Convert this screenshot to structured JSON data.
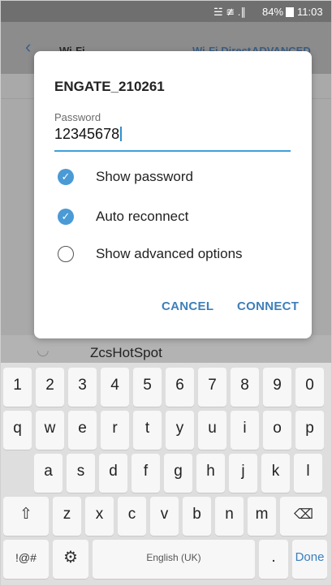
{
  "status_bar": {
    "signal_text": "☱ ≇ .∥",
    "battery": "84%",
    "time": "11:03"
  },
  "app_bar": {
    "back_icon": "back-arrow-icon",
    "title": "Wi-Fi",
    "wifi_direct": "Wi-Fi Direct",
    "advanced": "ADVANCED"
  },
  "background": {
    "network_name": "ZcsHotSpot"
  },
  "dialog": {
    "ssid": "ENGATE_210261",
    "password_label": "Password",
    "password_value": "12345678",
    "options": [
      {
        "label": "Show password",
        "checked": true
      },
      {
        "label": "Auto reconnect",
        "checked": true
      },
      {
        "label": "Show advanced options",
        "checked": false
      }
    ],
    "cancel": "CANCEL",
    "connect": "CONNECT"
  },
  "keyboard": {
    "row1": [
      "1",
      "2",
      "3",
      "4",
      "5",
      "6",
      "7",
      "8",
      "9",
      "0"
    ],
    "row2": [
      "q",
      "w",
      "e",
      "r",
      "t",
      "y",
      "u",
      "i",
      "o",
      "p"
    ],
    "row3": [
      "a",
      "s",
      "d",
      "f",
      "g",
      "h",
      "j",
      "k",
      "l"
    ],
    "row4": [
      "z",
      "x",
      "c",
      "v",
      "b",
      "n",
      "m"
    ],
    "shift": "⇧",
    "backspace": "⌫",
    "symbols": "!@#",
    "settings": "⚙",
    "space": "English (UK)",
    "period": ".",
    "done": "Done"
  },
  "colors": {
    "accent": "#3e7fb9",
    "check": "#4a9ad6",
    "underline": "#3ea0d8"
  }
}
